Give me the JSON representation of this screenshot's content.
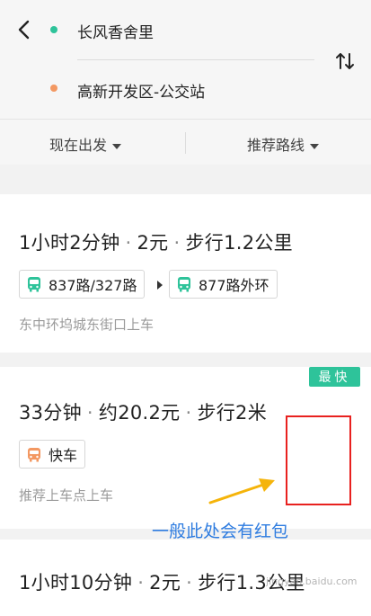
{
  "header": {
    "origin": "长风香舍里",
    "destination": "高新开发区-公交站",
    "back_icon": "chevron-left-icon",
    "swap_icon": "swap-vertical-icon",
    "colors": {
      "origin_dot": "#2ec39a",
      "destination_dot": "#f39862"
    }
  },
  "filters": {
    "depart": "现在出发",
    "route_pref": "推荐路线"
  },
  "routes": [
    {
      "time": "1小时2分钟",
      "price": "2元",
      "walk": "步行1.2公里",
      "lines": [
        "837路/327路",
        "877路外环"
      ],
      "boarding": "东中环坞城东街口上车"
    },
    {
      "badge": "最快",
      "time": "33分钟",
      "price": "约20.2元",
      "walk": "步行2米",
      "mode": "快车",
      "boarding": "推荐上车点上车"
    },
    {
      "time": "1小时10分钟",
      "price": "2元",
      "walk": "步行1.3公里"
    }
  ],
  "annotation": {
    "text": "一般此处会有红包",
    "highlight_color": "#e8211f",
    "arrow_color": "#f5b40a",
    "text_color": "#2e7ce0"
  },
  "watermark": "jingyan.baidu.com",
  "separator": "·"
}
